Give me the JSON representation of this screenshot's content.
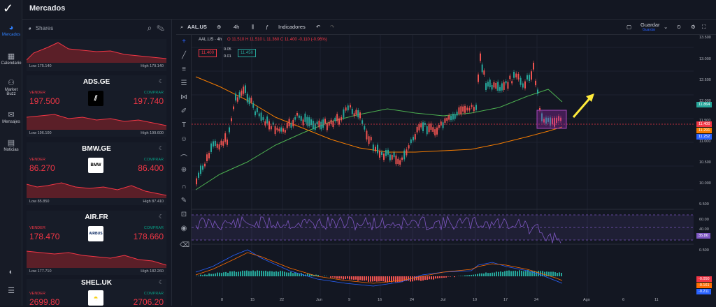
{
  "nav": {
    "items": [
      {
        "label": "Mercados",
        "icon": "pie-chart-icon",
        "active": true
      },
      {
        "label": "Calendario",
        "icon": "calendar-icon"
      },
      {
        "label": "Market Buzz",
        "icon": "buzz-icon"
      },
      {
        "label": "Mensajes",
        "icon": "mail-icon"
      },
      {
        "label": "Noticias",
        "icon": "news-icon"
      }
    ]
  },
  "header": {
    "title": "Mercados"
  },
  "watchlist": {
    "title": "Shares",
    "first_low": "Low 175.140",
    "first_high": "High 179.140",
    "cards": [
      {
        "symbol": "ADS.GE",
        "sell_label": "VENDER",
        "buy_label": "COMPRAR",
        "sell": "197.500",
        "buy": "197.740",
        "low": "Low 196.100",
        "high": "High 199.600",
        "logo": ""
      },
      {
        "symbol": "BMW.GE",
        "sell_label": "VENDER",
        "buy_label": "COMPRAR",
        "sell": "86.270",
        "buy": "86.400",
        "low": "Low 85.850",
        "high": "High 87.410",
        "logo": "BMW"
      },
      {
        "symbol": "AIR.FR",
        "sell_label": "VENDER",
        "buy_label": "COMPRAR",
        "sell": "178.470",
        "buy": "178.660",
        "low": "Low 177.710",
        "high": "High 182.260",
        "logo": "AIRBUS"
      },
      {
        "symbol": "SHEL.UK",
        "sell_label": "VENDER",
        "buy_label": "COMPRAR",
        "sell": "2699.80",
        "buy": "2706.20",
        "low": "",
        "high": "",
        "logo": ""
      }
    ]
  },
  "toolbar": {
    "symbol": "AAL.US",
    "interval": "4h",
    "indicators": "Indicadores",
    "save": "Guardar",
    "save_sub": "Guardar"
  },
  "chart": {
    "title": "AAL.US · 4h",
    "ohlc": "O 11.510  H 11.510  L 11.360  C 11.400  -0.110 (-0.96%)",
    "sell": "11.400",
    "spread": "0.05",
    "spread2": "0.01",
    "buy": "11.450",
    "y_labels": [
      "13.500",
      "13.000",
      "12.500",
      "12.000",
      "11.500",
      "11.000",
      "10.500",
      "10.000",
      "9.500"
    ],
    "price_tags": [
      {
        "v": "11.864",
        "c": "#26a69a"
      },
      {
        "v": "11.400",
        "c": "#f23645"
      },
      {
        "v": "11.291",
        "c": "#f57c00"
      },
      {
        "v": "11.252",
        "c": "#2962ff"
      }
    ],
    "rsi_labels": [
      "80.00",
      "60.00",
      "40.00"
    ],
    "rsi_tag": "35.86",
    "macd_labels": [
      "0.500"
    ],
    "macd_tags": [
      {
        "v": "-0.050",
        "c": "#f23645"
      },
      {
        "v": "-0.161",
        "c": "#ff6d00"
      },
      {
        "v": "-0.211",
        "c": "#2962ff"
      }
    ],
    "x_labels": [
      "8",
      "15",
      "22",
      "Jun",
      "9",
      "16",
      "24",
      "Jul",
      "10",
      "17",
      "24",
      "Ago",
      "6",
      "11"
    ]
  }
}
